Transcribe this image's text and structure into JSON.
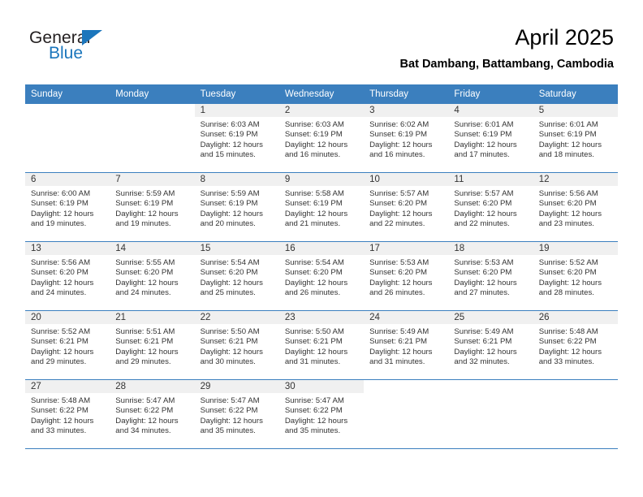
{
  "brand": {
    "name_top": "General",
    "name_bottom": "Blue",
    "accent_color": "#1b76bc",
    "triangle_icon": "triangle-icon"
  },
  "header": {
    "title": "April 2025",
    "subtitle": "Bat Dambang, Battambang, Cambodia"
  },
  "calendar": {
    "header_bg": "#3b7fbe",
    "daynum_bg": "#f0f0f0",
    "weekdays": [
      "Sunday",
      "Monday",
      "Tuesday",
      "Wednesday",
      "Thursday",
      "Friday",
      "Saturday"
    ],
    "weeks": [
      [
        {
          "day": "",
          "sunrise": "",
          "sunset": "",
          "daylight1": "",
          "daylight2": "",
          "state": "blank"
        },
        {
          "day": "",
          "sunrise": "",
          "sunset": "",
          "daylight1": "",
          "daylight2": "",
          "state": "blank"
        },
        {
          "day": "1",
          "sunrise": "Sunrise: 6:03 AM",
          "sunset": "Sunset: 6:19 PM",
          "daylight1": "Daylight: 12 hours",
          "daylight2": "and 15 minutes.",
          "state": "filled"
        },
        {
          "day": "2",
          "sunrise": "Sunrise: 6:03 AM",
          "sunset": "Sunset: 6:19 PM",
          "daylight1": "Daylight: 12 hours",
          "daylight2": "and 16 minutes.",
          "state": "filled"
        },
        {
          "day": "3",
          "sunrise": "Sunrise: 6:02 AM",
          "sunset": "Sunset: 6:19 PM",
          "daylight1": "Daylight: 12 hours",
          "daylight2": "and 16 minutes.",
          "state": "filled"
        },
        {
          "day": "4",
          "sunrise": "Sunrise: 6:01 AM",
          "sunset": "Sunset: 6:19 PM",
          "daylight1": "Daylight: 12 hours",
          "daylight2": "and 17 minutes.",
          "state": "filled"
        },
        {
          "day": "5",
          "sunrise": "Sunrise: 6:01 AM",
          "sunset": "Sunset: 6:19 PM",
          "daylight1": "Daylight: 12 hours",
          "daylight2": "and 18 minutes.",
          "state": "filled"
        }
      ],
      [
        {
          "day": "6",
          "sunrise": "Sunrise: 6:00 AM",
          "sunset": "Sunset: 6:19 PM",
          "daylight1": "Daylight: 12 hours",
          "daylight2": "and 19 minutes.",
          "state": "filled"
        },
        {
          "day": "7",
          "sunrise": "Sunrise: 5:59 AM",
          "sunset": "Sunset: 6:19 PM",
          "daylight1": "Daylight: 12 hours",
          "daylight2": "and 19 minutes.",
          "state": "filled"
        },
        {
          "day": "8",
          "sunrise": "Sunrise: 5:59 AM",
          "sunset": "Sunset: 6:19 PM",
          "daylight1": "Daylight: 12 hours",
          "daylight2": "and 20 minutes.",
          "state": "filled"
        },
        {
          "day": "9",
          "sunrise": "Sunrise: 5:58 AM",
          "sunset": "Sunset: 6:19 PM",
          "daylight1": "Daylight: 12 hours",
          "daylight2": "and 21 minutes.",
          "state": "filled"
        },
        {
          "day": "10",
          "sunrise": "Sunrise: 5:57 AM",
          "sunset": "Sunset: 6:20 PM",
          "daylight1": "Daylight: 12 hours",
          "daylight2": "and 22 minutes.",
          "state": "filled"
        },
        {
          "day": "11",
          "sunrise": "Sunrise: 5:57 AM",
          "sunset": "Sunset: 6:20 PM",
          "daylight1": "Daylight: 12 hours",
          "daylight2": "and 22 minutes.",
          "state": "filled"
        },
        {
          "day": "12",
          "sunrise": "Sunrise: 5:56 AM",
          "sunset": "Sunset: 6:20 PM",
          "daylight1": "Daylight: 12 hours",
          "daylight2": "and 23 minutes.",
          "state": "filled"
        }
      ],
      [
        {
          "day": "13",
          "sunrise": "Sunrise: 5:56 AM",
          "sunset": "Sunset: 6:20 PM",
          "daylight1": "Daylight: 12 hours",
          "daylight2": "and 24 minutes.",
          "state": "filled"
        },
        {
          "day": "14",
          "sunrise": "Sunrise: 5:55 AM",
          "sunset": "Sunset: 6:20 PM",
          "daylight1": "Daylight: 12 hours",
          "daylight2": "and 24 minutes.",
          "state": "filled"
        },
        {
          "day": "15",
          "sunrise": "Sunrise: 5:54 AM",
          "sunset": "Sunset: 6:20 PM",
          "daylight1": "Daylight: 12 hours",
          "daylight2": "and 25 minutes.",
          "state": "filled"
        },
        {
          "day": "16",
          "sunrise": "Sunrise: 5:54 AM",
          "sunset": "Sunset: 6:20 PM",
          "daylight1": "Daylight: 12 hours",
          "daylight2": "and 26 minutes.",
          "state": "filled"
        },
        {
          "day": "17",
          "sunrise": "Sunrise: 5:53 AM",
          "sunset": "Sunset: 6:20 PM",
          "daylight1": "Daylight: 12 hours",
          "daylight2": "and 26 minutes.",
          "state": "filled"
        },
        {
          "day": "18",
          "sunrise": "Sunrise: 5:53 AM",
          "sunset": "Sunset: 6:20 PM",
          "daylight1": "Daylight: 12 hours",
          "daylight2": "and 27 minutes.",
          "state": "filled"
        },
        {
          "day": "19",
          "sunrise": "Sunrise: 5:52 AM",
          "sunset": "Sunset: 6:20 PM",
          "daylight1": "Daylight: 12 hours",
          "daylight2": "and 28 minutes.",
          "state": "filled"
        }
      ],
      [
        {
          "day": "20",
          "sunrise": "Sunrise: 5:52 AM",
          "sunset": "Sunset: 6:21 PM",
          "daylight1": "Daylight: 12 hours",
          "daylight2": "and 29 minutes.",
          "state": "filled"
        },
        {
          "day": "21",
          "sunrise": "Sunrise: 5:51 AM",
          "sunset": "Sunset: 6:21 PM",
          "daylight1": "Daylight: 12 hours",
          "daylight2": "and 29 minutes.",
          "state": "filled"
        },
        {
          "day": "22",
          "sunrise": "Sunrise: 5:50 AM",
          "sunset": "Sunset: 6:21 PM",
          "daylight1": "Daylight: 12 hours",
          "daylight2": "and 30 minutes.",
          "state": "filled"
        },
        {
          "day": "23",
          "sunrise": "Sunrise: 5:50 AM",
          "sunset": "Sunset: 6:21 PM",
          "daylight1": "Daylight: 12 hours",
          "daylight2": "and 31 minutes.",
          "state": "filled"
        },
        {
          "day": "24",
          "sunrise": "Sunrise: 5:49 AM",
          "sunset": "Sunset: 6:21 PM",
          "daylight1": "Daylight: 12 hours",
          "daylight2": "and 31 minutes.",
          "state": "filled"
        },
        {
          "day": "25",
          "sunrise": "Sunrise: 5:49 AM",
          "sunset": "Sunset: 6:21 PM",
          "daylight1": "Daylight: 12 hours",
          "daylight2": "and 32 minutes.",
          "state": "filled"
        },
        {
          "day": "26",
          "sunrise": "Sunrise: 5:48 AM",
          "sunset": "Sunset: 6:22 PM",
          "daylight1": "Daylight: 12 hours",
          "daylight2": "and 33 minutes.",
          "state": "filled"
        }
      ],
      [
        {
          "day": "27",
          "sunrise": "Sunrise: 5:48 AM",
          "sunset": "Sunset: 6:22 PM",
          "daylight1": "Daylight: 12 hours",
          "daylight2": "and 33 minutes.",
          "state": "filled"
        },
        {
          "day": "28",
          "sunrise": "Sunrise: 5:47 AM",
          "sunset": "Sunset: 6:22 PM",
          "daylight1": "Daylight: 12 hours",
          "daylight2": "and 34 minutes.",
          "state": "filled"
        },
        {
          "day": "29",
          "sunrise": "Sunrise: 5:47 AM",
          "sunset": "Sunset: 6:22 PM",
          "daylight1": "Daylight: 12 hours",
          "daylight2": "and 35 minutes.",
          "state": "filled"
        },
        {
          "day": "30",
          "sunrise": "Sunrise: 5:47 AM",
          "sunset": "Sunset: 6:22 PM",
          "daylight1": "Daylight: 12 hours",
          "daylight2": "and 35 minutes.",
          "state": "filled"
        },
        {
          "day": "",
          "sunrise": "",
          "sunset": "",
          "daylight1": "",
          "daylight2": "",
          "state": "blank"
        },
        {
          "day": "",
          "sunrise": "",
          "sunset": "",
          "daylight1": "",
          "daylight2": "",
          "state": "blank"
        },
        {
          "day": "",
          "sunrise": "",
          "sunset": "",
          "daylight1": "",
          "daylight2": "",
          "state": "blank"
        }
      ]
    ]
  }
}
